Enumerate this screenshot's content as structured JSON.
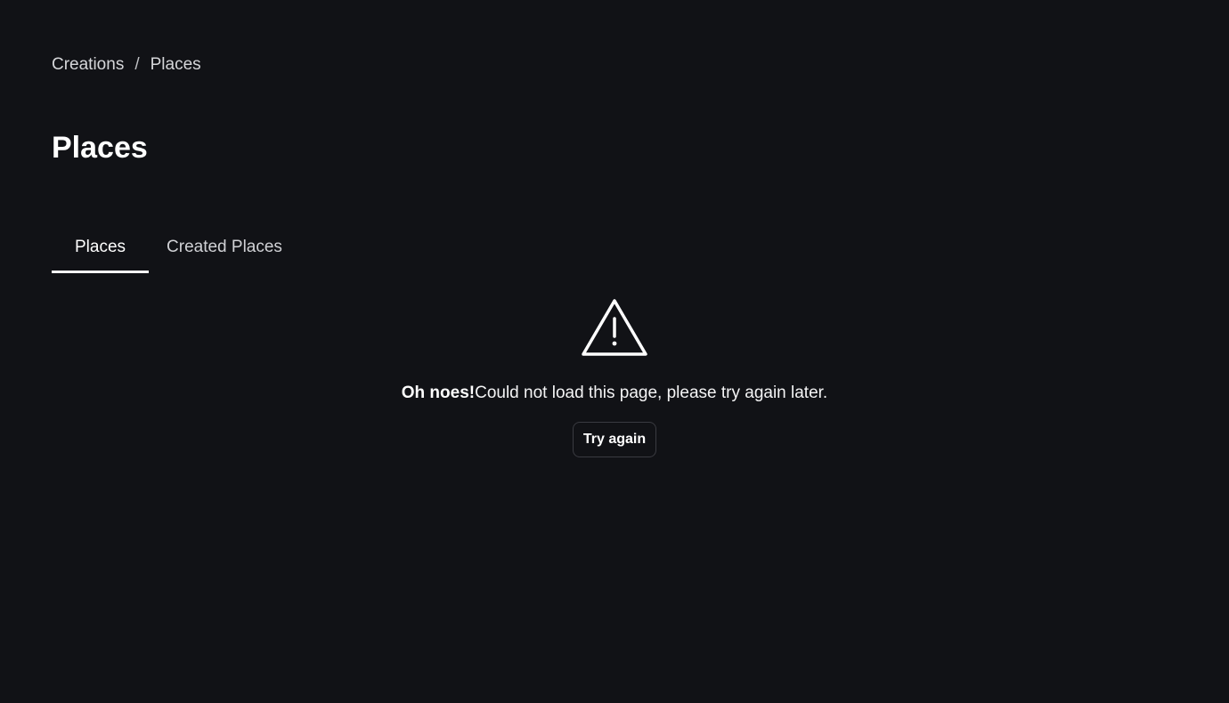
{
  "breadcrumb": {
    "items": [
      "Creations",
      "Places"
    ],
    "separator": "/"
  },
  "page": {
    "title": "Places"
  },
  "tabs": [
    {
      "label": "Places",
      "active": true
    },
    {
      "label": "Created Places",
      "active": false
    }
  ],
  "error": {
    "icon": "warning-triangle-icon",
    "heading": "Oh noes!",
    "message": "Could not load this page, please try again later.",
    "retry_label": "Try again"
  },
  "colors": {
    "background": "#111216",
    "text": "#f2f2f3",
    "border": "#3a3b41"
  }
}
